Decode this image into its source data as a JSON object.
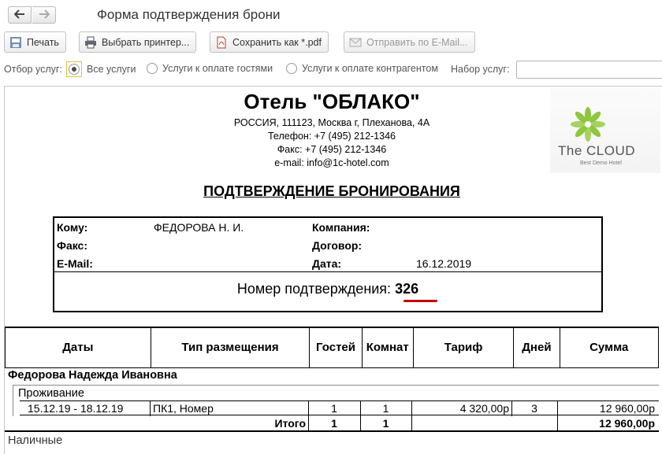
{
  "window": {
    "title": "Форма подтверждения брони",
    "back_symbol": "🡐",
    "forward_symbol": "🡒"
  },
  "toolbar": {
    "print": "Печать",
    "select_printer": "Выбрать принтер...",
    "save_pdf": "Сохранить как *.pdf",
    "send_email": "Отправить по E-Mail..."
  },
  "filter": {
    "label": "Отбор услуг:",
    "options": [
      "Все услуги",
      "Услуги к оплате гостями",
      "Услуги к оплате контрагентом"
    ],
    "selected": "Все услуги",
    "set_label": "Набор услуг:",
    "set_value": ""
  },
  "document": {
    "hotel_name": "Отель \"ОБЛАКО\"",
    "address": "РОССИЯ, 111123, Москва г, Плеханова, 4А",
    "phone": "Телефон: +7 (495) 212-1346",
    "fax": "Факс: +7 (495) 212-1346",
    "email": "e-mail: info@1c-hotel.com",
    "logo_name": "The CLOUD",
    "logo_sub": "Best Demo Hotel",
    "confirm_title": "ПОДТВЕРЖДЕНИЕ БРОНИРОВАНИЯ",
    "info": {
      "to_label": "Кому:",
      "to_value": "ФЕДОРОВА Н. И.",
      "fax_label": "Факс:",
      "email_label": "E-Mail:",
      "company_label": "Компания:",
      "contract_label": "Договор:",
      "date_label": "Дата:",
      "date_value": "16.12.2019",
      "confirm_number_label": "Номер подтверждения:",
      "confirm_number": "326"
    },
    "table": {
      "headers": [
        "Даты",
        "Тип размещения",
        "Гостей",
        "Комнат",
        "Тариф",
        "Дней",
        "Сумма"
      ],
      "guest_name": "Федорова Надежда Ивановна",
      "group": "Проживание",
      "row": {
        "dates": "15.12.19 - 18.12.19",
        "type": "ПК1, Номер",
        "guests": "1",
        "rooms": "1",
        "rate": "4 320,00р",
        "days": "3",
        "sum": "12 960,00р"
      },
      "total": {
        "label": "Итого",
        "guests": "1",
        "rooms": "1",
        "sum": "12 960,00р"
      },
      "payment": "Наличные"
    }
  },
  "colors": {
    "accent_red": "#c00000",
    "logo_green": "#8dc63f"
  }
}
